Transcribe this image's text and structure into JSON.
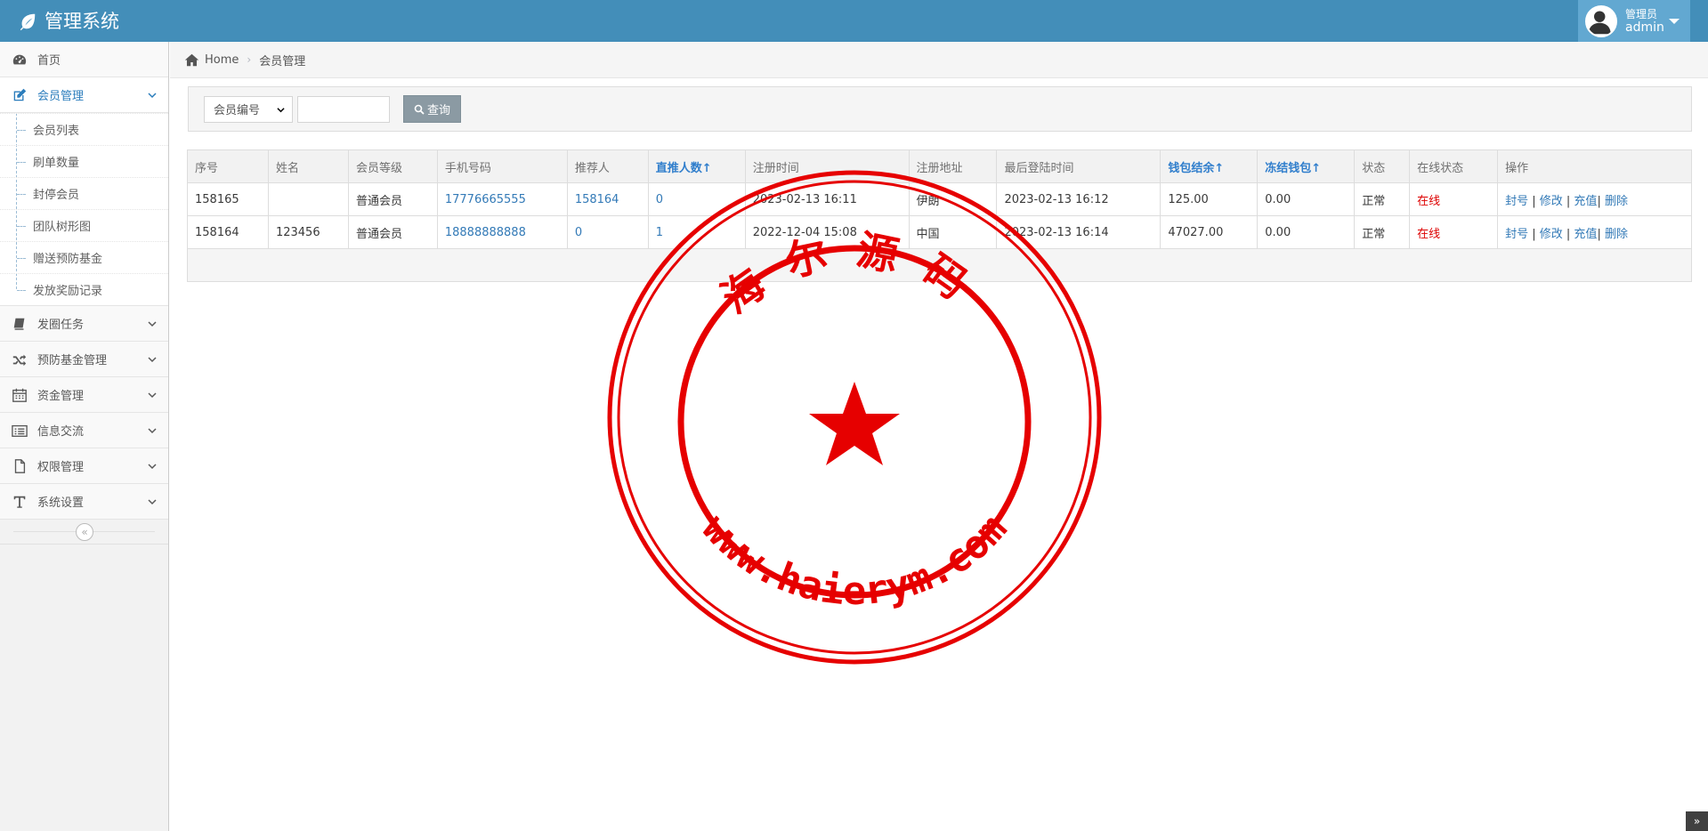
{
  "navbar": {
    "brand": "管理系统",
    "user_role": "管理员",
    "user_name": "admin"
  },
  "sidebar": {
    "items": [
      {
        "label": "首页",
        "icon": "dashboard-icon"
      },
      {
        "label": "会员管理",
        "icon": "edit-icon",
        "active": true
      },
      {
        "label": "发圈任务",
        "icon": "book-icon"
      },
      {
        "label": "预防基金管理",
        "icon": "random-icon"
      },
      {
        "label": "资金管理",
        "icon": "calendar-icon"
      },
      {
        "label": "信息交流",
        "icon": "list-icon"
      },
      {
        "label": "权限管理",
        "icon": "file-icon"
      },
      {
        "label": "系统设置",
        "icon": "text-icon"
      }
    ],
    "sub_items": [
      "会员列表",
      "刷单数量",
      "封停会员",
      "团队树形图",
      "赠送预防基金",
      "发放奖励记录"
    ]
  },
  "breadcrumb": {
    "home": "Home",
    "current": "会员管理"
  },
  "search": {
    "select_value": "会员编号",
    "button_label": "查询"
  },
  "table": {
    "headers": [
      "序号",
      "姓名",
      "会员等级",
      "手机号码",
      "推荐人",
      "直推人数↑",
      "注册时间",
      "注册地址",
      "最后登陆时间",
      "钱包结余↑",
      "冻结钱包↑",
      "状态",
      "在线状态",
      "操作"
    ],
    "rows": [
      [
        "158165",
        "",
        "普通会员",
        "17776665555",
        "158164",
        "0",
        "2023-02-13 16:11",
        "伊朗",
        "2023-02-13 16:12",
        "125.00",
        "0.00",
        "正常",
        "在线"
      ],
      [
        "158164",
        "123456",
        "普通会员",
        "18888888888",
        "0",
        "1",
        "2022-12-04 15:08",
        "中国",
        "2023-02-13 16:14",
        "47027.00",
        "0.00",
        "正常",
        "在线"
      ]
    ],
    "ops": [
      "封号",
      "修改",
      "充值",
      "删除"
    ]
  },
  "watermark": {
    "top_text": "海尔源码",
    "bottom_text": "www.haierym.com",
    "color": "#e60000"
  },
  "colors": {
    "navbar": "#438eb9",
    "link": "#337ab7",
    "online": "#dd0000"
  }
}
